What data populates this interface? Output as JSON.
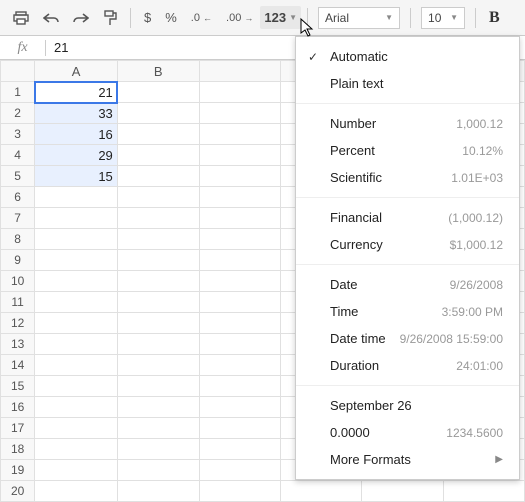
{
  "toolbar": {
    "currency_icon": "$",
    "percent_icon": "%",
    "dec_dec": ".0",
    "dec_inc": ".00",
    "format_label": "123",
    "font_name": "Arial",
    "font_size": "10",
    "bold": "B"
  },
  "formula_bar": {
    "label": "fx",
    "value": "21"
  },
  "columns": [
    "A",
    "B"
  ],
  "rows": [
    "1",
    "2",
    "3",
    "4",
    "5",
    "6",
    "7",
    "8",
    "9",
    "10",
    "11",
    "12",
    "13",
    "14",
    "15",
    "16",
    "17",
    "18",
    "19",
    "20"
  ],
  "cells": {
    "A1": "21",
    "A2": "33",
    "A3": "16",
    "A4": "29",
    "A5": "15"
  },
  "menu": {
    "automatic": "Automatic",
    "plain": "Plain text",
    "number": {
      "label": "Number",
      "ex": "1,000.12"
    },
    "percent": {
      "label": "Percent",
      "ex": "10.12%"
    },
    "scientific": {
      "label": "Scientific",
      "ex": "1.01E+03"
    },
    "financial": {
      "label": "Financial",
      "ex": "(1,000.12)"
    },
    "currency": {
      "label": "Currency",
      "ex": "$1,000.12"
    },
    "date": {
      "label": "Date",
      "ex": "9/26/2008"
    },
    "time": {
      "label": "Time",
      "ex": "3:59:00 PM"
    },
    "datetime": {
      "label": "Date time",
      "ex": "9/26/2008 15:59:00"
    },
    "duration": {
      "label": "Duration",
      "ex": "24:01:00"
    },
    "custom_date": "September 26",
    "custom_num": {
      "label": "0.0000",
      "ex": "1234.5600"
    },
    "more": "More Formats"
  }
}
